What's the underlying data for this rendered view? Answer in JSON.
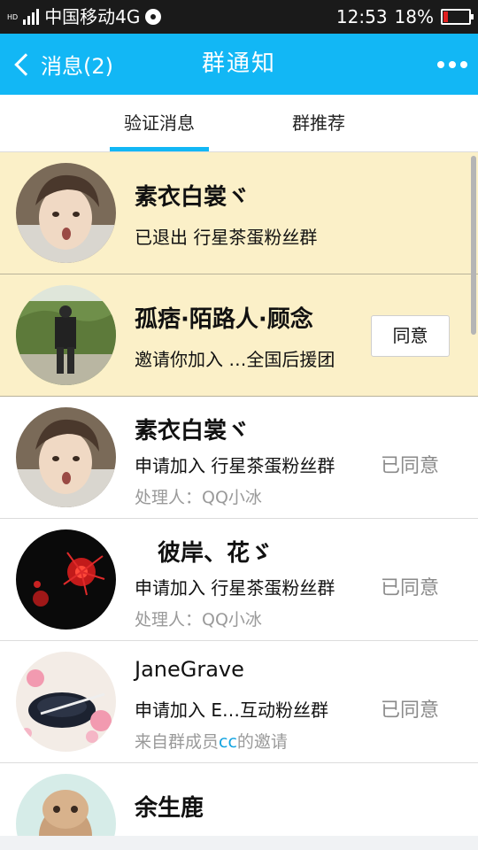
{
  "status_bar": {
    "network_badge": "HD",
    "carrier": "中国移动4G",
    "time": "12:53",
    "battery_percent": "18%",
    "battery_level": 0.18
  },
  "header": {
    "back_label": "消息(2)",
    "title": "群通知"
  },
  "tabs": [
    {
      "label": "验证消息",
      "active": true
    },
    {
      "label": "群推荐",
      "active": false
    }
  ],
  "agree_label": "同意",
  "notifications": [
    {
      "name": "素衣白裳ヾ",
      "desc": "已退出 行星茶蛋粉丝群",
      "sub": "",
      "status": "",
      "unread": true
    },
    {
      "name": "孤痞·陌路人·顾念",
      "desc": "邀请你加入 …全国后援团",
      "sub": "",
      "status": "",
      "unread": true
    },
    {
      "name": "素衣白裳ヾ",
      "desc": "申请加入 行星茶蛋粉丝群",
      "sub": "处理人：QQ小冰",
      "status": "已同意",
      "unread": false
    },
    {
      "name": "彼岸、花ゞ",
      "desc": "申请加入 行星茶蛋粉丝群",
      "sub": "处理人：QQ小冰",
      "status": "已同意",
      "unread": false
    },
    {
      "name": "JaneGrave",
      "desc": "申请加入 E…互动粉丝群",
      "sub_prefix": "来自群成员",
      "sub_inviter": "cc",
      "sub_suffix": "的邀请",
      "status": "已同意",
      "unread": false
    },
    {
      "name": "余生鹿",
      "desc": "",
      "sub": "",
      "status": "",
      "unread": false
    }
  ],
  "colors": {
    "accent": "#12b7f5",
    "unread_bg": "#fbf0c8",
    "status_gray": "#8a8a8a",
    "inviter_link": "#12a3e0"
  }
}
